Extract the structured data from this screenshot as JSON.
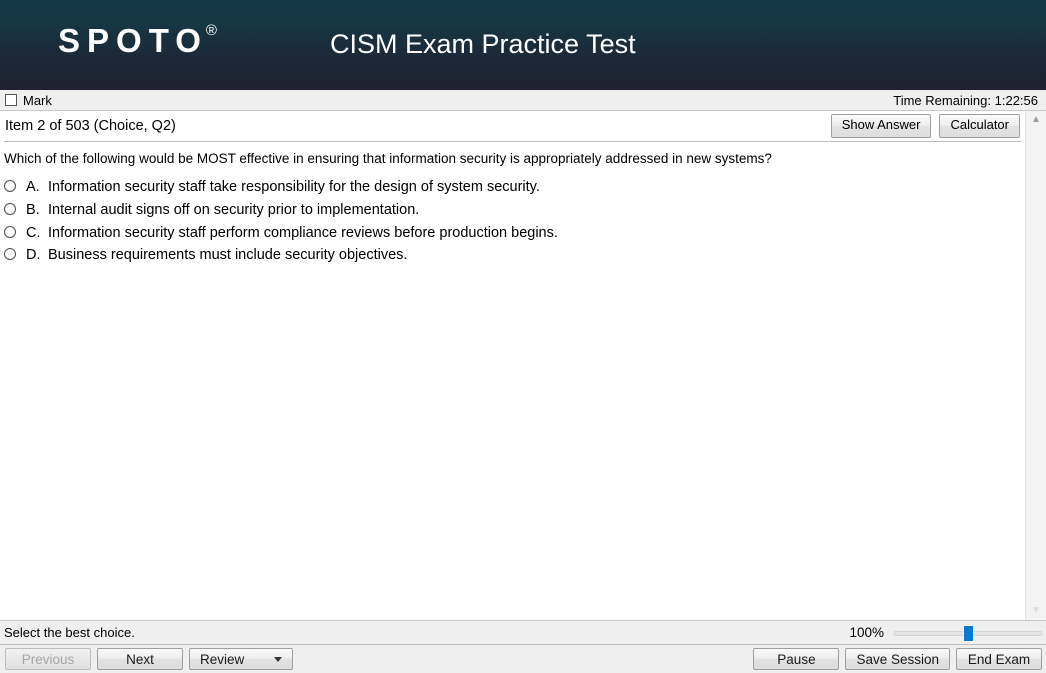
{
  "banner": {
    "logo": "SPOTO",
    "logo_reg": "®",
    "title": "CISM Exam Practice Test"
  },
  "markbar": {
    "mark_label": "Mark",
    "timer_label": "Time Remaining: 1:22:56"
  },
  "itembar": {
    "item_label": "Item 2 of 503 (Choice, Q2)",
    "show_answer_label": "Show Answer",
    "calculator_label": "Calculator"
  },
  "question": {
    "text": "Which of the following would be MOST effective in ensuring that information security is appropriately addressed in new systems?",
    "choices": [
      {
        "letter": "A.",
        "text": "Information security staff take responsibility for the design of system security."
      },
      {
        "letter": "B.",
        "text": "Internal audit signs off on security prior to implementation."
      },
      {
        "letter": "C.",
        "text": "Information security staff perform compliance reviews before production begins."
      },
      {
        "letter": "D.",
        "text": "Business requirements must include security objectives."
      }
    ]
  },
  "statusbar": {
    "hint": "Select the best choice.",
    "zoom_percent": "100%"
  },
  "toolbar": {
    "previous_label": "Previous",
    "next_label": "Next",
    "review_label": "Review",
    "pause_label": "Pause",
    "save_session_label": "Save Session",
    "end_exam_label": "End Exam"
  },
  "colors": {
    "banner_top": "#143847",
    "banner_bottom": "#1f2030",
    "slider_thumb": "#0a7bd4"
  }
}
